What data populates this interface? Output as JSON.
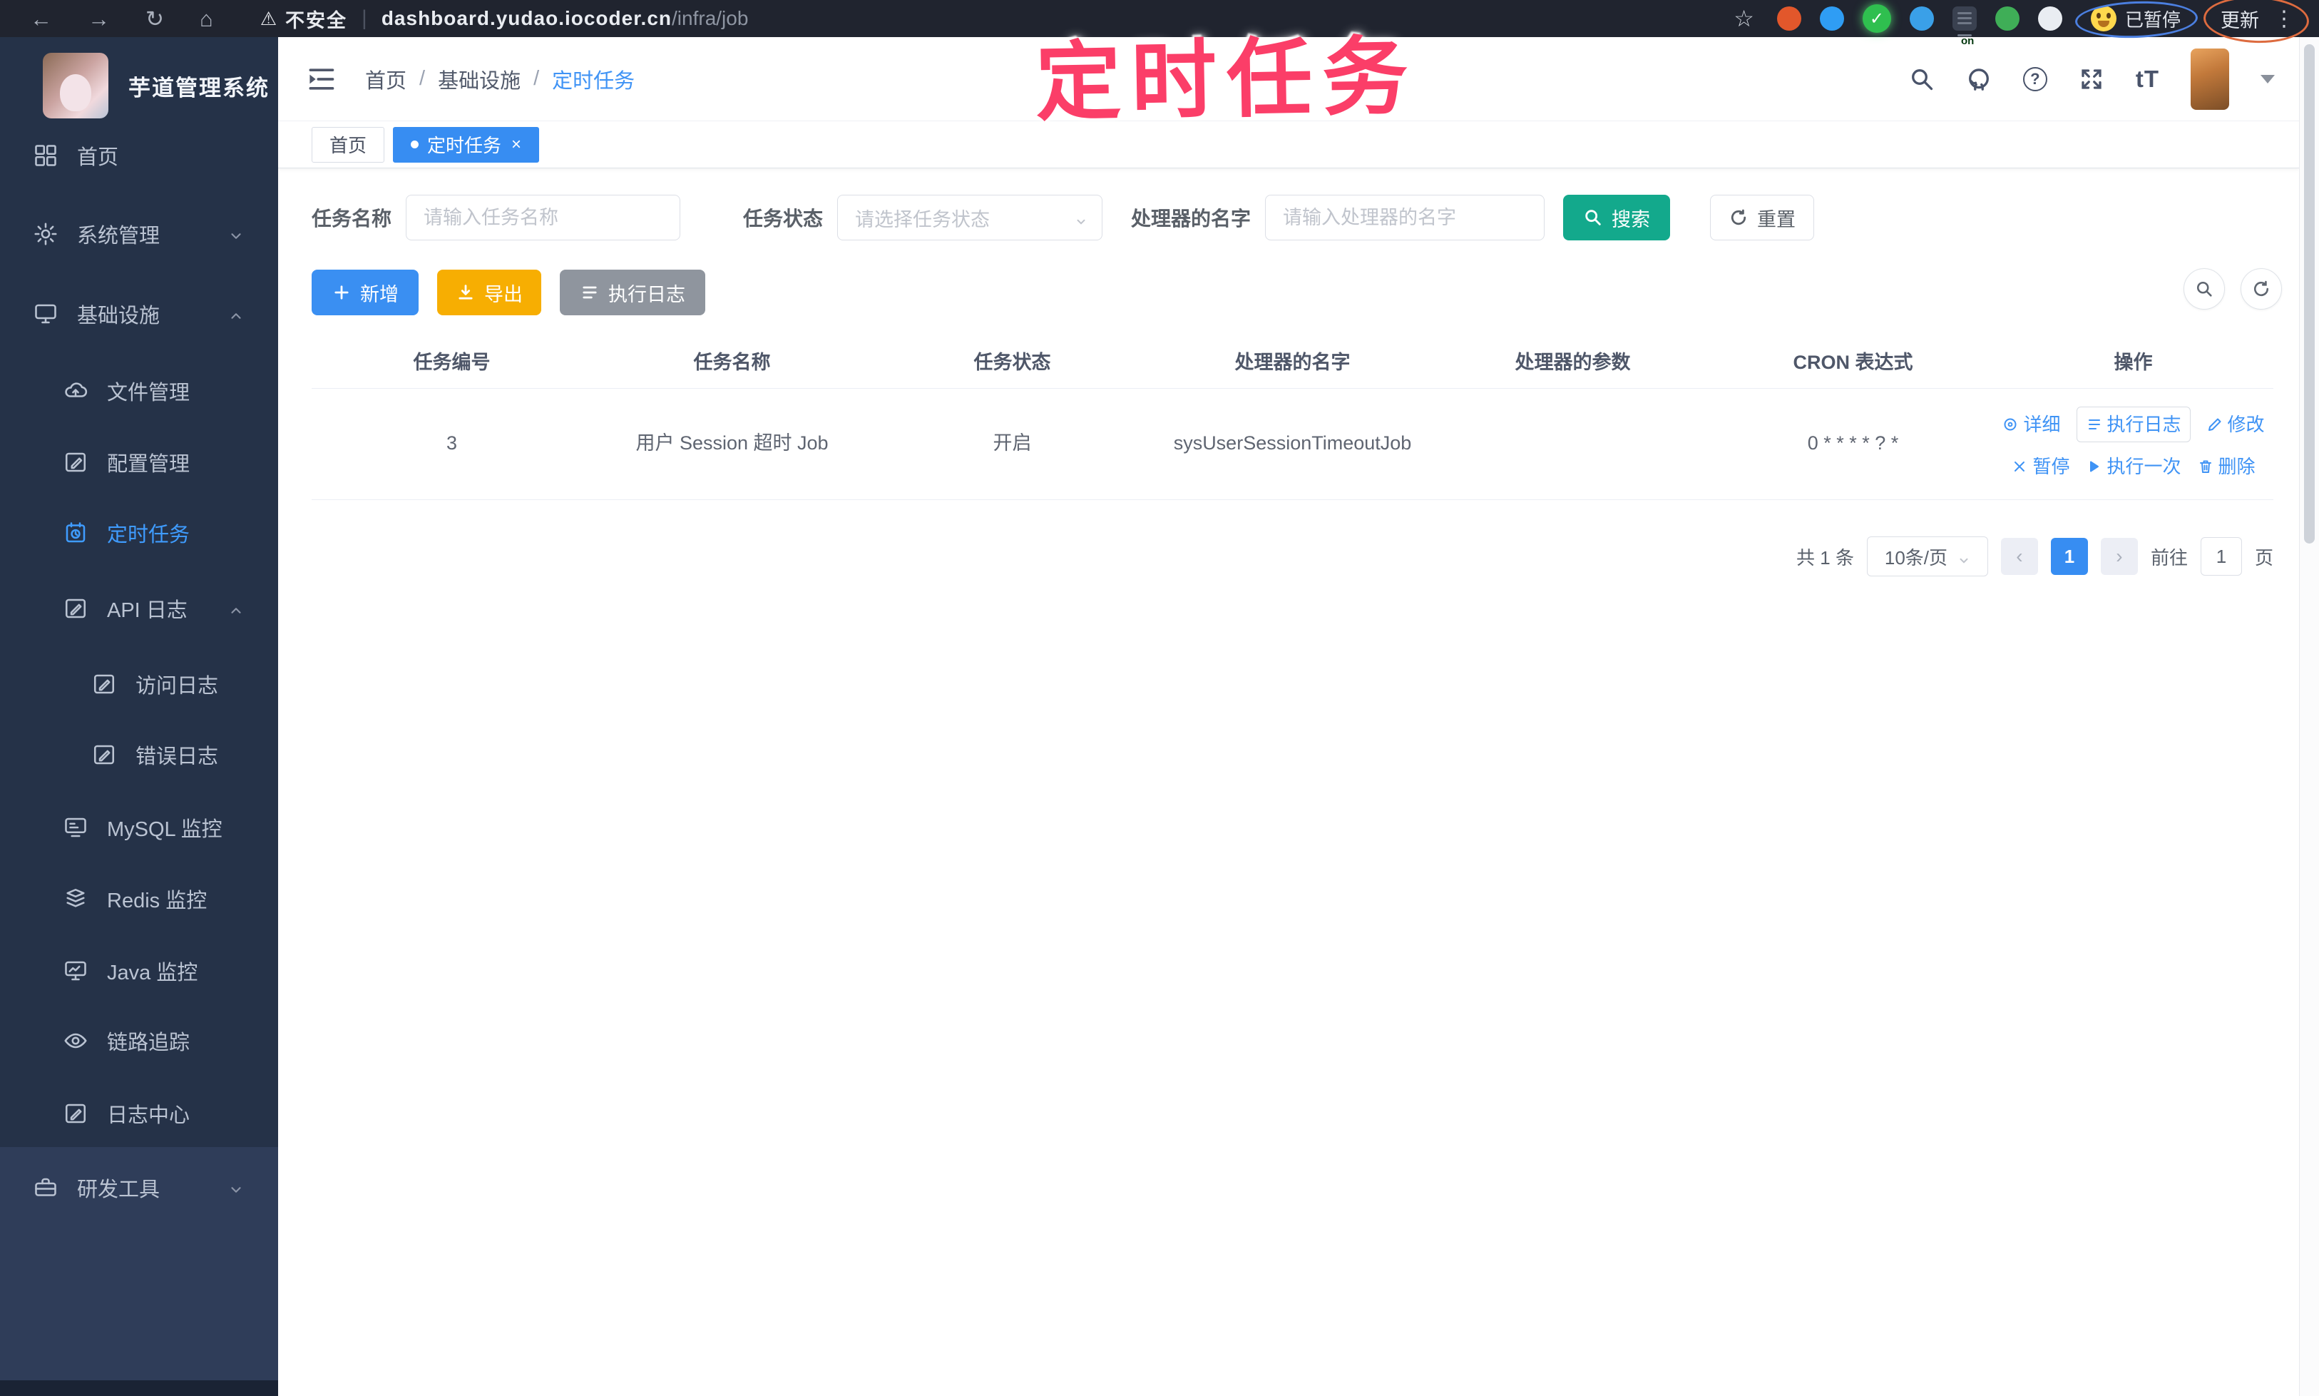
{
  "annotation": {
    "title": "定时任务"
  },
  "browser": {
    "security_label": "不安全",
    "url_host": "dashboard.yudao.iocoder.cn",
    "url_path": "/infra/job",
    "profile_status": "已暂停",
    "update_label": "更新",
    "glyphs": {
      "back": "←",
      "forward": "→",
      "reload": "↻",
      "home": "⌂",
      "warning": "⚠",
      "star": "☆",
      "menu": "⋮",
      "on_badge": "on",
      "check": "✓"
    }
  },
  "sidebar": {
    "app_title": "芋道管理系统",
    "items": [
      {
        "label": "首页"
      },
      {
        "label": "系统管理"
      },
      {
        "label": "基础设施"
      },
      {
        "label": "文件管理"
      },
      {
        "label": "配置管理"
      },
      {
        "label": "定时任务"
      },
      {
        "label": "API 日志"
      },
      {
        "label": "访问日志"
      },
      {
        "label": "错误日志"
      },
      {
        "label": "MySQL 监控"
      },
      {
        "label": "Redis 监控"
      },
      {
        "label": "Java 监控"
      },
      {
        "label": "链路追踪"
      },
      {
        "label": "日志中心"
      },
      {
        "label": "研发工具"
      }
    ]
  },
  "header": {
    "breadcrumb": [
      "首页",
      "基础设施",
      "定时任务"
    ],
    "separator": "/",
    "font_size_icon_label": "tT",
    "help_glyph": "?"
  },
  "tabs": [
    {
      "label": "首页"
    },
    {
      "label": "定时任务",
      "close": "×"
    }
  ],
  "filters": {
    "name_label": "任务名称",
    "name_placeholder": "请输入任务名称",
    "status_label": "任务状态",
    "status_placeholder": "请选择任务状态",
    "handler_label": "处理器的名字",
    "handler_placeholder": "请输入处理器的名字",
    "search_label": "搜索",
    "reset_label": "重置"
  },
  "toolbar": {
    "add_label": "新增",
    "export_label": "导出",
    "exec_log_label": "执行日志"
  },
  "table": {
    "columns": [
      "任务编号",
      "任务名称",
      "任务状态",
      "处理器的名字",
      "处理器的参数",
      "CRON 表达式",
      "操作"
    ],
    "row": {
      "id": "3",
      "name": "用户 Session 超时 Job",
      "status": "开启",
      "handler": "sysUserSessionTimeoutJob",
      "param": "",
      "cron": "0 * * * * ? *"
    },
    "actions": {
      "detail": "详细",
      "exec_log": "执行日志",
      "edit": "修改",
      "pause": "暂停",
      "run_once": "执行一次",
      "delete": "删除"
    }
  },
  "pagination": {
    "total": "共 1 条",
    "page_size": "10条/页",
    "prev_glyph": "‹",
    "next_glyph": "›",
    "page": "1",
    "goto_label": "前往",
    "goto_value": "1",
    "page_unit": "页"
  },
  "colors": {
    "accent_blue": "#3a8ff2",
    "teal": "#13a98c",
    "warning_yellow": "#f7ae02",
    "info_gray": "#8f959e",
    "annotation_pink": "#fb3e68"
  }
}
